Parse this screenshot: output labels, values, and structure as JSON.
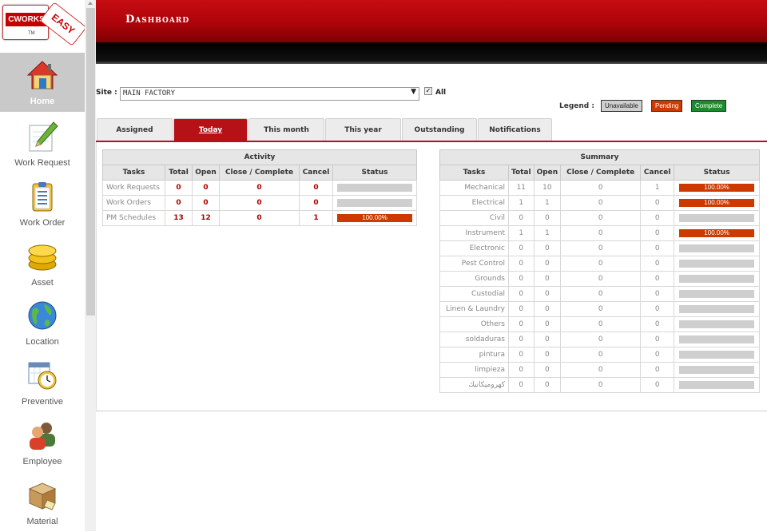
{
  "app": {
    "logo_text": "CWORKS",
    "logo_tag": "EASY",
    "logo_tm": "TM",
    "header_title": "Dashboard"
  },
  "sidebar": {
    "items": [
      {
        "label": "Home",
        "icon": "home-icon",
        "active": true
      },
      {
        "label": "Work Request",
        "icon": "pencil-icon"
      },
      {
        "label": "Work Order",
        "icon": "clipboard-icon"
      },
      {
        "label": "Asset",
        "icon": "coins-icon"
      },
      {
        "label": "Location",
        "icon": "globe-icon"
      },
      {
        "label": "Preventive",
        "icon": "calendar-clock-icon"
      },
      {
        "label": "Employee",
        "icon": "people-icon"
      },
      {
        "label": "Material",
        "icon": "box-icon"
      }
    ]
  },
  "site": {
    "label": "Site :",
    "value": "MAIN FACTORY",
    "arrow": "▼",
    "all_label": "All",
    "all_checked": true
  },
  "legend": {
    "label": "Legend :",
    "items": [
      {
        "label": "Unavailable",
        "color": "#cfcfcf"
      },
      {
        "label": "Pending",
        "color": "#cc3a00"
      },
      {
        "label": "Complete",
        "color": "#1e8a2e"
      }
    ]
  },
  "tabs": [
    {
      "label": "Assigned",
      "active": false
    },
    {
      "label": "Today",
      "active": true
    },
    {
      "label": "This month",
      "active": false
    },
    {
      "label": "This year",
      "active": false
    },
    {
      "label": "Outstanding",
      "active": false
    },
    {
      "label": "Notifications",
      "active": false
    }
  ],
  "activity": {
    "title": "Activity",
    "columns": [
      "Tasks",
      "Total",
      "Open",
      "Close / Complete",
      "Cancel",
      "Status"
    ],
    "rows": [
      {
        "task": "Work Requests",
        "total": "0",
        "open": "0",
        "close": "0",
        "cancel": "0",
        "status": ""
      },
      {
        "task": "Work Orders",
        "total": "0",
        "open": "0",
        "close": "0",
        "cancel": "0",
        "status": ""
      },
      {
        "task": "PM Schedules",
        "total": "13",
        "open": "12",
        "close": "0",
        "cancel": "1",
        "status": "100.00%"
      }
    ]
  },
  "summary": {
    "title": "Summary",
    "columns": [
      "Tasks",
      "Total",
      "Open",
      "Close / Complete",
      "Cancel",
      "Status"
    ],
    "rows": [
      {
        "task": "Mechanical",
        "total": "11",
        "open": "10",
        "close": "0",
        "cancel": "1",
        "status": "100.00%"
      },
      {
        "task": "Electrical",
        "total": "1",
        "open": "1",
        "close": "0",
        "cancel": "0",
        "status": "100.00%"
      },
      {
        "task": "Civil",
        "total": "0",
        "open": "0",
        "close": "0",
        "cancel": "0",
        "status": ""
      },
      {
        "task": "Instrument",
        "total": "1",
        "open": "1",
        "close": "0",
        "cancel": "0",
        "status": "100.00%"
      },
      {
        "task": "Electronic",
        "total": "0",
        "open": "0",
        "close": "0",
        "cancel": "0",
        "status": ""
      },
      {
        "task": "Pest Control",
        "total": "0",
        "open": "0",
        "close": "0",
        "cancel": "0",
        "status": ""
      },
      {
        "task": "Grounds",
        "total": "0",
        "open": "0",
        "close": "0",
        "cancel": "0",
        "status": ""
      },
      {
        "task": "Custodial",
        "total": "0",
        "open": "0",
        "close": "0",
        "cancel": "0",
        "status": ""
      },
      {
        "task": "Linen & Laundry",
        "total": "0",
        "open": "0",
        "close": "0",
        "cancel": "0",
        "status": ""
      },
      {
        "task": "Others",
        "total": "0",
        "open": "0",
        "close": "0",
        "cancel": "0",
        "status": ""
      },
      {
        "task": "soldaduras",
        "total": "0",
        "open": "0",
        "close": "0",
        "cancel": "0",
        "status": ""
      },
      {
        "task": "pintura",
        "total": "0",
        "open": "0",
        "close": "0",
        "cancel": "0",
        "status": ""
      },
      {
        "task": "limpieza",
        "total": "0",
        "open": "0",
        "close": "0",
        "cancel": "0",
        "status": ""
      },
      {
        "task": "كهروميكانيك",
        "total": "0",
        "open": "0",
        "close": "0",
        "cancel": "0",
        "status": ""
      }
    ]
  },
  "colors": {
    "brand_red": "#b61117",
    "pending": "#cc3a00",
    "unavailable": "#cfcfcf",
    "complete": "#1e8a2e"
  }
}
